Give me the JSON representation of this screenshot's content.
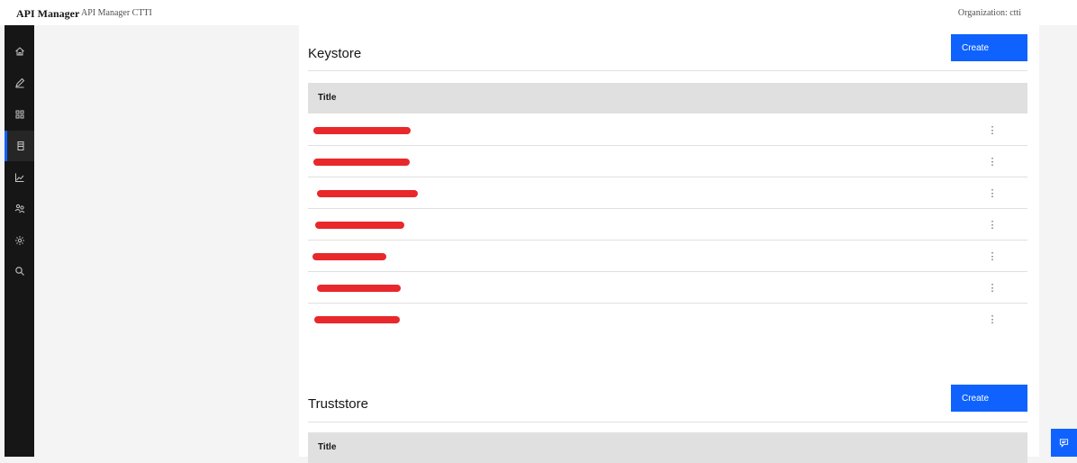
{
  "header": {
    "brand": "API Manager",
    "instance": "API Manager CTTI",
    "organization": "Organization: ctti"
  },
  "nav": {
    "items": [
      {
        "icon": "home-icon",
        "active": false
      },
      {
        "icon": "edit-icon",
        "active": false
      },
      {
        "icon": "apps-icon",
        "active": false
      },
      {
        "icon": "resources-icon",
        "active": true
      },
      {
        "icon": "analytics-icon",
        "active": false
      },
      {
        "icon": "members-icon",
        "active": false
      },
      {
        "icon": "settings-icon",
        "active": false
      },
      {
        "icon": "search-icon",
        "active": false
      }
    ]
  },
  "keystore": {
    "title": "Keystore",
    "create_label": "Create",
    "column_title": "Title",
    "rows": [
      {
        "label": "",
        "overflow": "⋮"
      },
      {
        "label": "",
        "overflow": "⋮"
      },
      {
        "label": "",
        "overflow": "⋮"
      },
      {
        "label": "",
        "overflow": "⋮"
      },
      {
        "label": "",
        "overflow": "⋮"
      },
      {
        "label": "",
        "overflow": "⋮"
      },
      {
        "label": "",
        "overflow": "⋮"
      }
    ]
  },
  "truststore": {
    "title": "Truststore",
    "create_label": "Create",
    "column_title": "Title"
  },
  "colors": {
    "accent": "#0f62fe",
    "redaction": "#e8282b",
    "nav_bg": "#161616"
  }
}
